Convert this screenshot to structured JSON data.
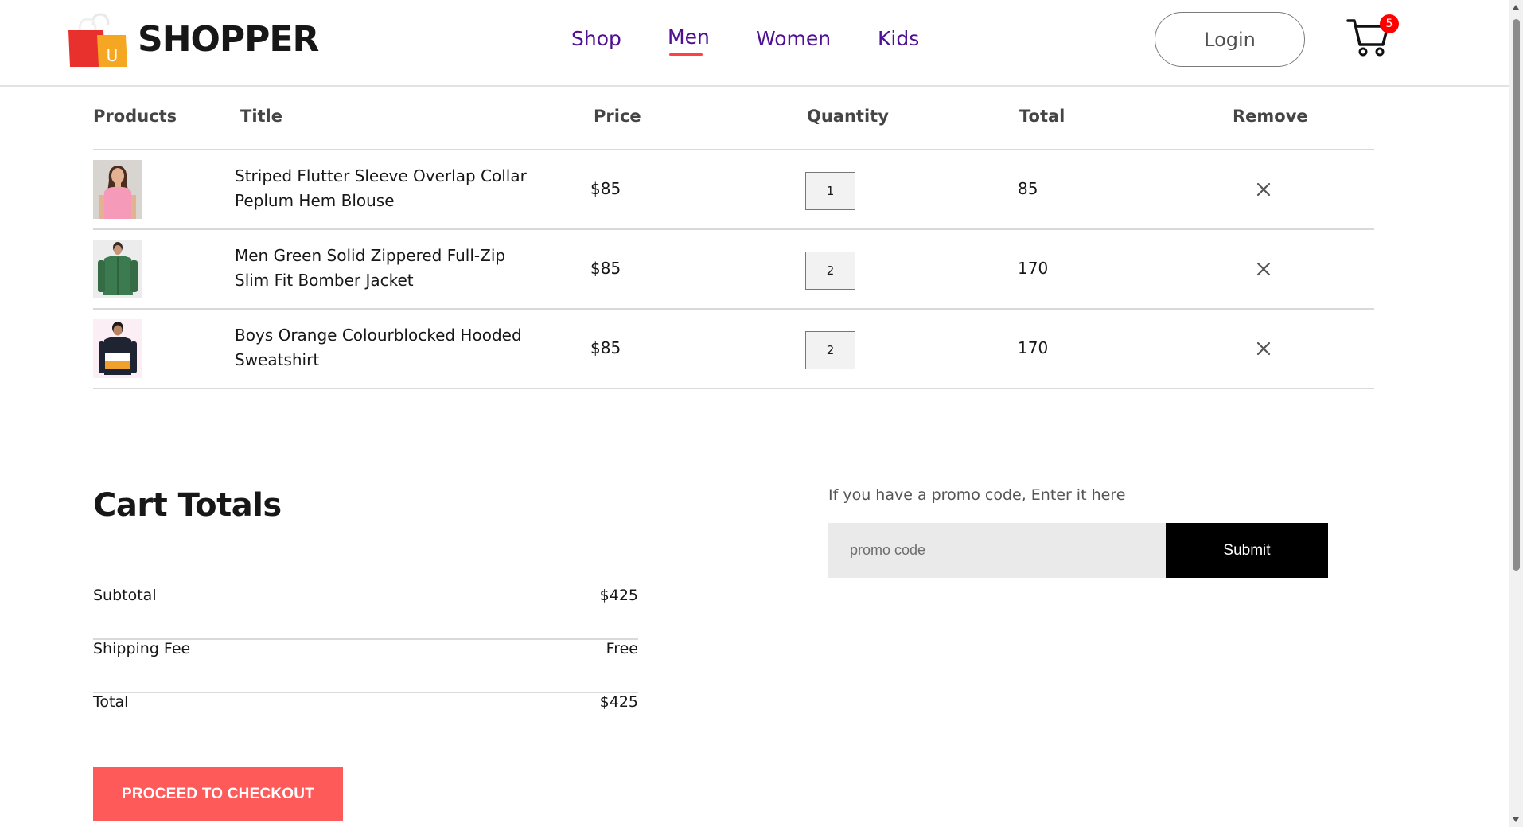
{
  "brand": {
    "name": "SHOPPER",
    "logo_letter": "U"
  },
  "nav": {
    "items": [
      {
        "label": "Shop"
      },
      {
        "label": "Men"
      },
      {
        "label": "Women"
      },
      {
        "label": "Kids"
      }
    ],
    "active": "Men",
    "login_label": "Login",
    "cart_count": "5"
  },
  "cart": {
    "headers": {
      "products": "Products",
      "title": "Title",
      "price": "Price",
      "quantity": "Quantity",
      "total": "Total",
      "remove": "Remove"
    },
    "items": [
      {
        "title": "Striped Flutter Sleeve Overlap Collar Peplum Hem Blouse",
        "price": "$85",
        "quantity": "1",
        "total": "85",
        "thumb_icon": "pink-blouse-model"
      },
      {
        "title": "Men Green Solid Zippered Full-Zip Slim Fit Bomber Jacket",
        "price": "$85",
        "quantity": "2",
        "total": "170",
        "thumb_icon": "green-jacket-model"
      },
      {
        "title": "Boys Orange Colourblocked Hooded Sweatshirt",
        "price": "$85",
        "quantity": "2",
        "total": "170",
        "thumb_icon": "hooded-sweatshirt-model"
      }
    ]
  },
  "totals": {
    "title": "Cart Totals",
    "subtotal_label": "Subtotal",
    "subtotal_value": "$425",
    "shipping_label": "Shipping Fee",
    "shipping_value": "Free",
    "total_label": "Total",
    "total_value": "$425",
    "checkout_label": "PROCEED TO CHECKOUT"
  },
  "promo": {
    "text": "If you have a promo code, Enter it here",
    "placeholder": "promo code",
    "submit_label": "Submit"
  },
  "colors": {
    "accent": "#ff4141",
    "nav_text": "#4e0f93",
    "checkout_bg": "#ff5a5a",
    "badge": "#ff0000"
  }
}
